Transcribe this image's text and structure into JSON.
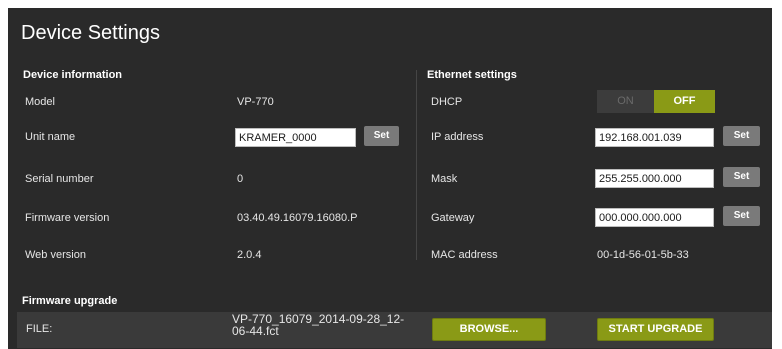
{
  "page": {
    "title": "Device Settings"
  },
  "device_info": {
    "heading": "Device information",
    "rows": [
      {
        "label": "Model",
        "value": "VP-770"
      },
      {
        "label": "Unit name",
        "value": "KRAMER_0000"
      },
      {
        "label": "Serial number",
        "value": "0"
      },
      {
        "label": "Firmware version",
        "value": "03.40.49.16079.16080.P"
      },
      {
        "label": "Web version",
        "value": "2.0.4"
      }
    ],
    "set_label": "Set"
  },
  "ethernet": {
    "heading": "Ethernet settings",
    "dhcp": {
      "label": "DHCP",
      "on_label": "ON",
      "off_label": "OFF",
      "state": "OFF"
    },
    "ip": {
      "label": "IP address",
      "value": "192.168.001.039"
    },
    "mask": {
      "label": "Mask",
      "value": "255.255.000.000"
    },
    "gateway": {
      "label": "Gateway",
      "value": "000.000.000.000"
    },
    "mac": {
      "label": "MAC address",
      "value": "00-1d-56-01-5b-33"
    },
    "set_label": "Set"
  },
  "firmware_upgrade": {
    "heading": "Firmware upgrade",
    "file_label": "FILE:",
    "file_name": "VP-770_16079_2014-09-28_12-06-44.fct",
    "browse_label": "BROWSE...",
    "start_label": "START UPGRADE"
  },
  "colors": {
    "panel_bg": "#2a2a2a",
    "accent_olive": "#8a9a16",
    "set_button": "#7a7a7a"
  }
}
